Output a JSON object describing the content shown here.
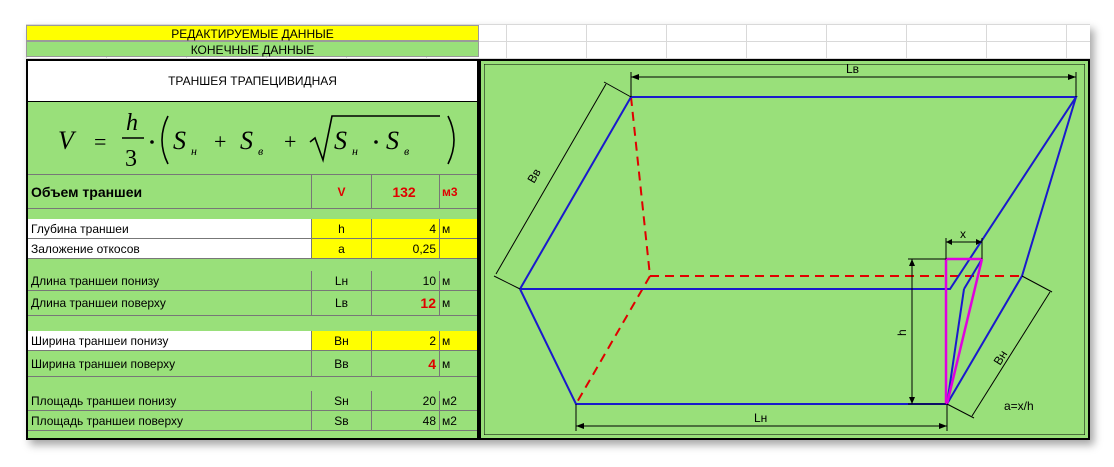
{
  "header": {
    "editable": "РЕДАКТИРУЕМЫЕ ДАННЫЕ",
    "final": "КОНЕЧНЫЕ ДАННЫЕ"
  },
  "panel": {
    "title": "ТРАНШЕЯ ТРАПЕЦИВИДНАЯ",
    "formula": {
      "v": "V",
      "eq": "=",
      "h": "h",
      "three": "3",
      "s": "S",
      "sub_n": "н",
      "sub_v": "в"
    },
    "volume": {
      "label": "Объем траншеи",
      "symbol": "V",
      "value": "132",
      "unit": "м3"
    },
    "rows": [
      {
        "label": "Глубина траншеи",
        "symbol": "h",
        "value": "4",
        "unit": "м"
      },
      {
        "label": "Заложение откосов",
        "symbol": "a",
        "value": "0,25",
        "unit": ""
      },
      {
        "label": "Длина траншеи понизу",
        "symbol": "Lн",
        "value": "10",
        "unit": "м"
      },
      {
        "label": "Длина траншеи поверху",
        "symbol": "Lв",
        "value": "12",
        "unit": "м"
      },
      {
        "label": "Ширина траншеи понизу",
        "symbol": "Bн",
        "value": "2",
        "unit": "м"
      },
      {
        "label": "Ширина траншеи поверху",
        "symbol": "Bв",
        "value": "4",
        "unit": "м"
      },
      {
        "label": "Площадь траншеи понизу",
        "symbol": "Sн",
        "value": "20",
        "unit": "м2"
      },
      {
        "label": "Площадь траншеи поверху",
        "symbol": "Sв",
        "value": "48",
        "unit": "м2"
      }
    ]
  },
  "diagram": {
    "labels": {
      "lv": "Lв",
      "bv": "Вв",
      "x": "x",
      "h": "h",
      "bn": "Вн",
      "ln": "Lн",
      "a": "a=x/h"
    },
    "colors": {
      "edge": "#1a1acc",
      "hidden": "#e00000",
      "slope": "#e000e0",
      "bg": "#99e07a"
    }
  }
}
